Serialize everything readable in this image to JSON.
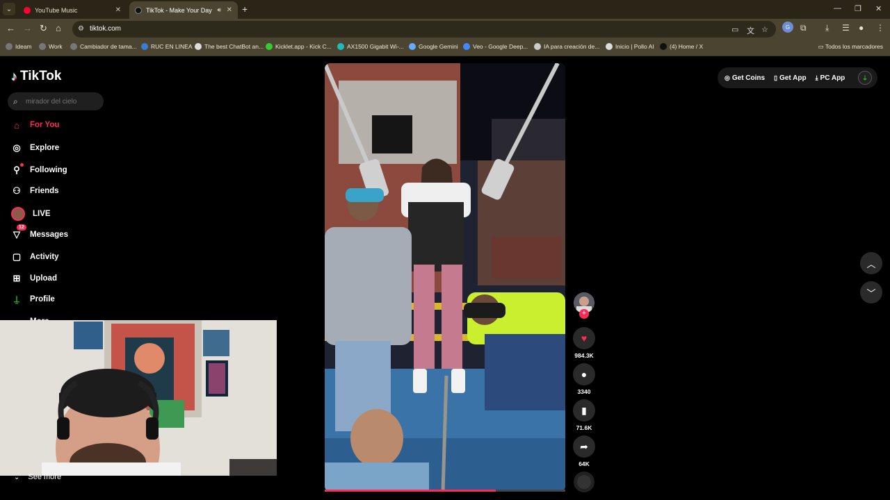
{
  "browser": {
    "tabs": [
      {
        "title": "YouTube Music",
        "color": "#ff0033",
        "active": false
      },
      {
        "title": "TikTok - Make Your Day",
        "color": "#111111",
        "active": true
      }
    ],
    "url": "tiktok.com",
    "bookmarks": [
      {
        "label": "Ideam",
        "icon": "bookmark-icon"
      },
      {
        "label": "Work",
        "icon": "globe-icon"
      },
      {
        "label": "Cambiador de tama...",
        "icon": "dollar-icon"
      },
      {
        "label": "RUC EN LINEA",
        "icon": "cloud-icon"
      },
      {
        "label": "The best ChatBot an...",
        "icon": "diamond-icon"
      },
      {
        "label": "Kicklet.app - Kick C...",
        "icon": "k-icon"
      },
      {
        "label": "AX1500 Gigabit Wi-...",
        "icon": "wifi-icon"
      },
      {
        "label": "Google Gemini",
        "icon": "gemini-icon"
      },
      {
        "label": "Veo - Google Deep...",
        "icon": "veo-icon"
      },
      {
        "label": "IA para creación de...",
        "icon": "ai-icon"
      },
      {
        "label": "Inicio | Pollo AI",
        "icon": "p-icon"
      },
      {
        "label": "(4) Home / X",
        "icon": "x-icon"
      }
    ],
    "all_bookmarks": "Todos los marcadores"
  },
  "tiktok": {
    "logo": "TikTok",
    "search_placeholder": "mirador del cielo",
    "nav": {
      "for_you": "For You",
      "explore": "Explore",
      "following": "Following",
      "friends": "Friends",
      "live": "LIVE",
      "messages": "Messages",
      "messages_badge": "12",
      "activity": "Activity",
      "upload": "Upload",
      "profile": "Profile",
      "more": "More",
      "see_more": "See more"
    },
    "top_right": {
      "get_coins": "Get Coins",
      "get_app": "Get App",
      "pc_app": "PC App"
    },
    "actions": {
      "likes": "984.3K",
      "comments": "3340",
      "saves": "71.6K",
      "shares": "64K"
    },
    "video_progress": 0.71,
    "colors": {
      "accent": "#fe2c55",
      "chrome_dark": "#2a2516",
      "chrome": "#4a4430"
    }
  }
}
